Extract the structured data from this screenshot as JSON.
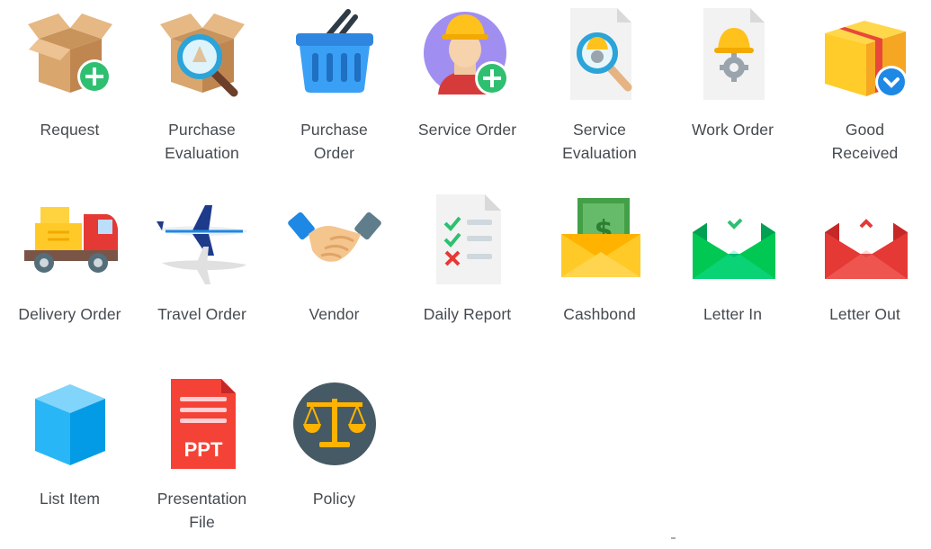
{
  "menu": {
    "items": [
      {
        "label": "Request",
        "icon": "request-box-plus-icon"
      },
      {
        "label": "Purchase\nEvaluation",
        "icon": "box-magnifier-icon"
      },
      {
        "label": "Purchase\nOrder",
        "icon": "shopping-basket-icon"
      },
      {
        "label": "Service Order",
        "icon": "worker-plus-icon"
      },
      {
        "label": "Service\nEvaluation",
        "icon": "document-magnifier-icon"
      },
      {
        "label": "Work Order",
        "icon": "document-helmet-gear-icon"
      },
      {
        "label": "Good\nReceived",
        "icon": "package-download-icon"
      },
      {
        "label": "Delivery Order",
        "icon": "delivery-truck-icon"
      },
      {
        "label": "Travel Order",
        "icon": "airplanes-icon"
      },
      {
        "label": "Vendor",
        "icon": "handshake-icon"
      },
      {
        "label": "Daily Report",
        "icon": "checklist-icon"
      },
      {
        "label": "Cashbond",
        "icon": "money-envelope-icon"
      },
      {
        "label": "Letter In",
        "icon": "envelope-in-icon"
      },
      {
        "label": "Letter Out",
        "icon": "envelope-out-icon"
      },
      {
        "label": "List Item",
        "icon": "cube-icon"
      },
      {
        "label": "Presentation\nFile",
        "icon": "ppt-file-icon"
      },
      {
        "label": "Policy",
        "icon": "scales-icon"
      }
    ],
    "ppt_text": "PPT"
  }
}
